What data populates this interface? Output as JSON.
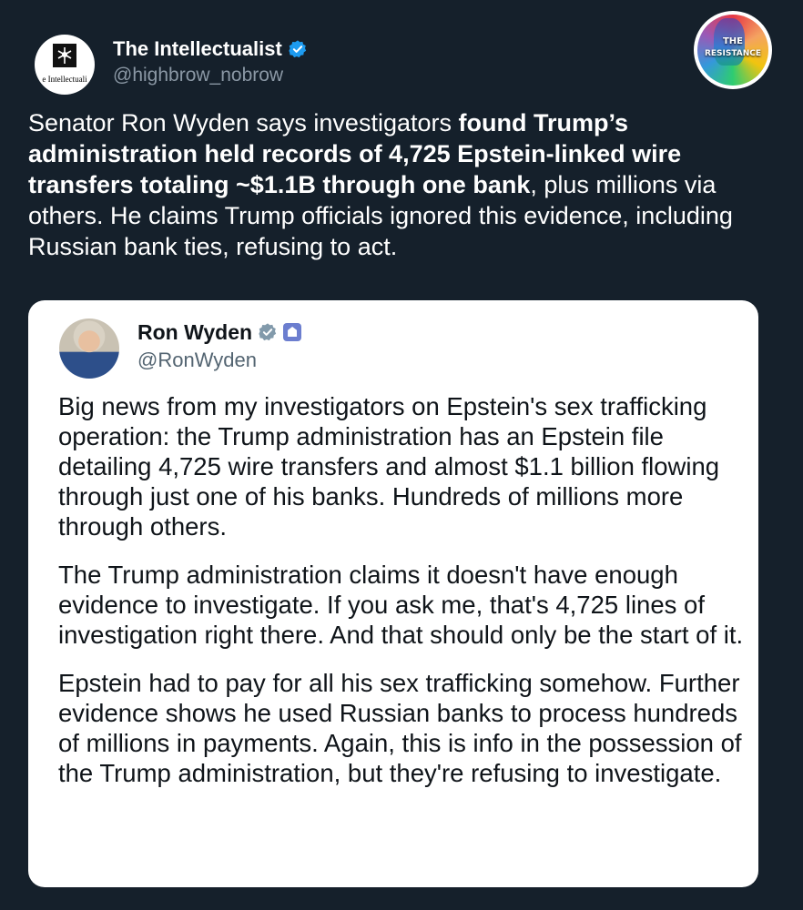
{
  "header": {
    "display_name": "The Intellectualist",
    "handle": "@highbrow_nobrow",
    "avatar_text": "e Intellectuali",
    "verified_color": "#1d9bf0"
  },
  "badge": {
    "line1": "THE",
    "line2": "RESISTANCE"
  },
  "tweet": {
    "part1": "Senator Ron Wyden says investigators ",
    "bold": "found Trump’s administration held records of 4,725 Epstein-linked wire transfers totaling ~$1.1B through one bank",
    "part2": ", plus millions via others. He claims Trump officials ignored this evidence, including Russian bank ties, refusing to act."
  },
  "quote": {
    "display_name": "Ron Wyden",
    "handle": "@RonWyden",
    "verified_color": "#829aab",
    "gov_badge_color": "#6c7ecf",
    "paragraphs": [
      "Big news from my investigators on Epstein's sex trafficking operation: the Trump administration has an Epstein file detailing 4,725 wire transfers and almost $1.1 billion flowing through just one of his banks. Hundreds of millions more through others.",
      "The Trump administration claims it doesn't have enough evidence to investigate. If you ask me, that's 4,725 lines of investigation right there. And that should only be the start of it.",
      "Epstein had to pay for all his sex trafficking somehow. Further evidence shows he used Russian banks to process hundreds of millions in payments. Again, this is info in the possession of the Trump administration, but they're refusing to investigate."
    ]
  }
}
